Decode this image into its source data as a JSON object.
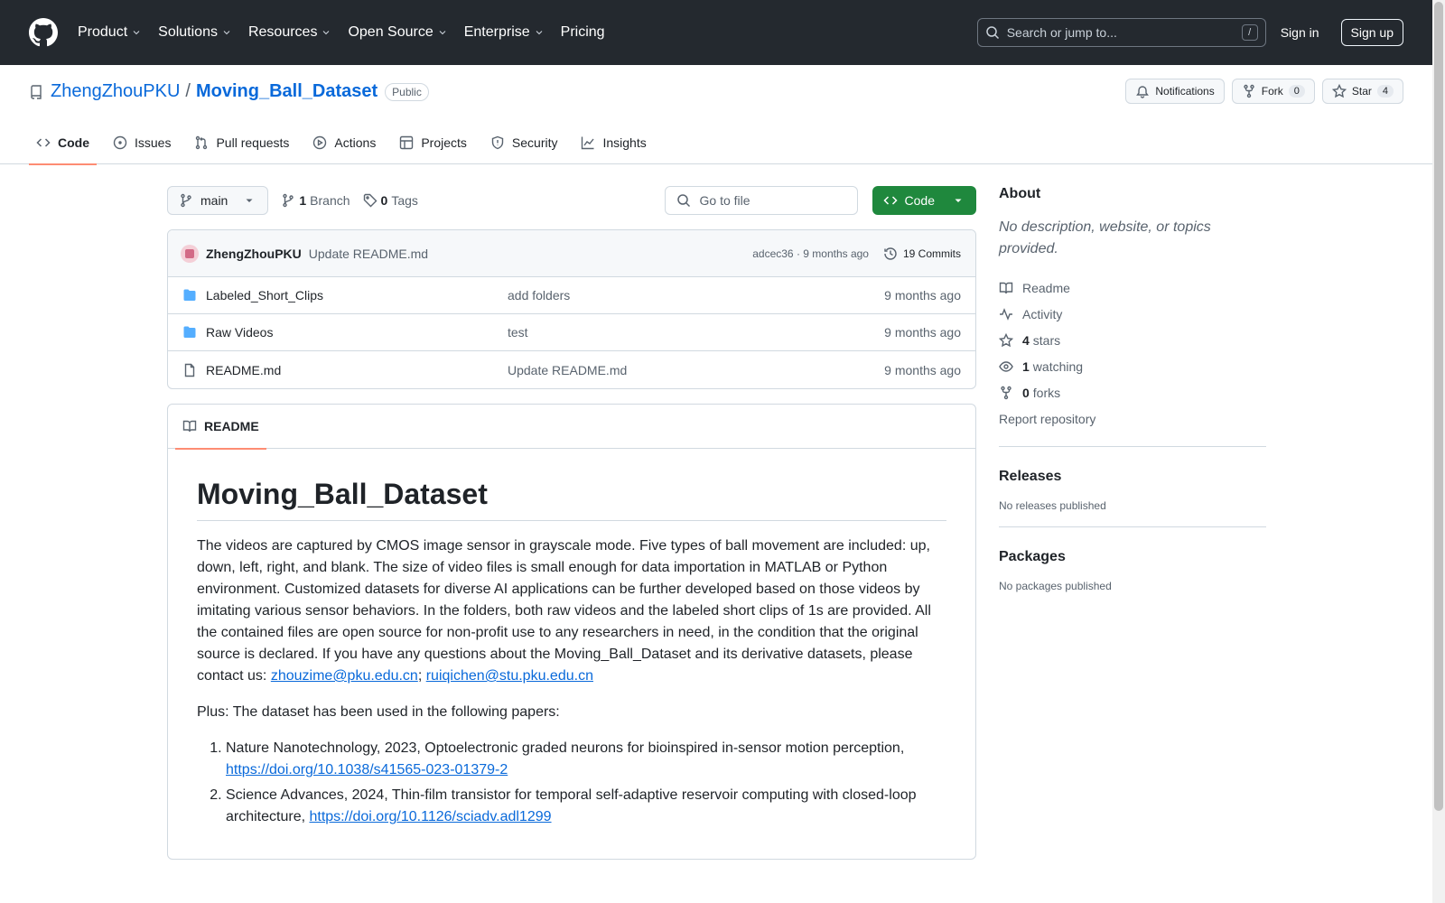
{
  "header": {
    "nav": [
      "Product",
      "Solutions",
      "Resources",
      "Open Source",
      "Enterprise",
      "Pricing"
    ],
    "search_placeholder": "Search or jump to...",
    "search_shortcut": "/",
    "sign_in": "Sign in",
    "sign_up": "Sign up"
  },
  "repo": {
    "owner": "ZhengZhouPKU",
    "separator": "/",
    "name": "Moving_Ball_Dataset",
    "visibility": "Public",
    "notifications": "Notifications",
    "fork_label": "Fork",
    "fork_count": "0",
    "star_label": "Star",
    "star_count": "4"
  },
  "tabs": [
    "Code",
    "Issues",
    "Pull requests",
    "Actions",
    "Projects",
    "Security",
    "Insights"
  ],
  "toolbar": {
    "branch": "main",
    "branch_count": "1",
    "branch_label": "Branch",
    "tag_count": "0",
    "tag_label": "Tags",
    "goto_placeholder": "Go to file",
    "code_label": "Code"
  },
  "commit": {
    "author": "ZhengZhouPKU",
    "message": "Update README.md",
    "meta": "adcec36 · 9 months ago",
    "commits": "19 Commits"
  },
  "files": [
    {
      "name": "Labeled_Short_Clips",
      "type": "folder",
      "message": "add folders",
      "age": "9 months ago"
    },
    {
      "name": "Raw Videos",
      "type": "folder",
      "message": "test",
      "age": "9 months ago"
    },
    {
      "name": "README.md",
      "type": "file",
      "message": "Update README.md",
      "age": "9 months ago"
    }
  ],
  "readme": {
    "tab": "README",
    "title": "Moving_Ball_Dataset",
    "para1": "The videos are captured by CMOS image sensor in grayscale mode. Five types of ball movement are included: up, down, left, right, and blank. The size of video files is small enough for data importation in MATLAB or Python environment. Customized datasets for diverse AI applications can be further developed based on those videos by imitating various sensor behaviors. In the folders, both raw videos and the labeled short clips of 1s are provided. All the contained files are open source for non-profit use to any researchers in need, in the condition that the original source is declared. If you have any questions about the Moving_Ball_Dataset and its derivative datasets, please contact us: ",
    "email1": "zhouzime@pku.edu.cn",
    "email_sep": "; ",
    "email2": "ruiqichen@stu.pku.edu.cn",
    "para2": "Plus: The dataset has been used in the following papers:",
    "papers": [
      {
        "text": "Nature Nanotechnology, 2023, Optoelectronic graded neurons for bioinspired in-sensor motion perception, ",
        "link": "https://doi.org/10.1038/s41565-023-01379-2"
      },
      {
        "text": "Science Advances, 2024, Thin-film transistor for temporal self-adaptive reservoir computing with closed-loop architecture, ",
        "link": "https://doi.org/10.1126/sciadv.adl1299"
      }
    ]
  },
  "sidebar": {
    "about_title": "About",
    "about_desc": "No description, website, or topics provided.",
    "readme": "Readme",
    "activity": "Activity",
    "stars_count": "4",
    "stars_label": "stars",
    "watching_count": "1",
    "watching_label": "watching",
    "forks_count": "0",
    "forks_label": "forks",
    "report": "Report repository",
    "releases_title": "Releases",
    "releases_desc": "No releases published",
    "packages_title": "Packages",
    "packages_desc": "No packages published"
  },
  "colors": {
    "header_bg": "#24292f",
    "accent": "#0969da",
    "primary_button": "#1f883d",
    "active_tab_underline": "#fd8c73",
    "folder_icon": "#54aeff"
  }
}
